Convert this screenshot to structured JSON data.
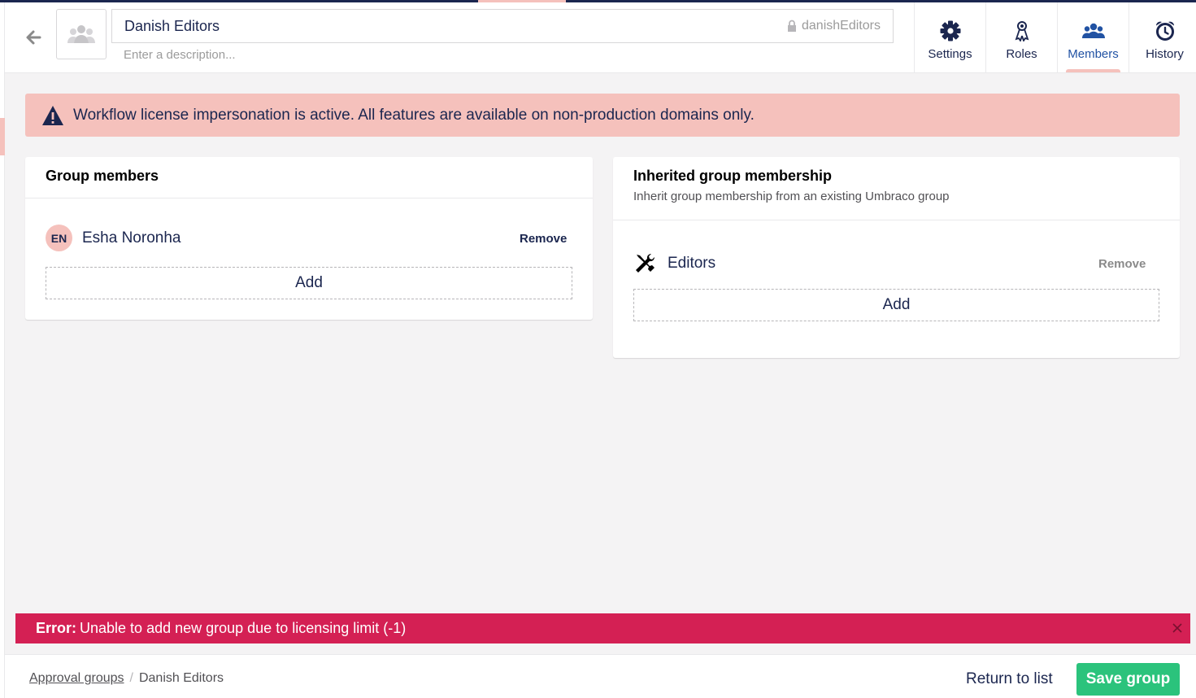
{
  "header": {
    "group_name": "Danish Editors",
    "alias": "danishEditors",
    "description_placeholder": "Enter a description...",
    "tabs": [
      {
        "label": "Settings",
        "icon": "gear-icon"
      },
      {
        "label": "Roles",
        "icon": "roles-icon"
      },
      {
        "label": "Members",
        "icon": "users-icon",
        "active": true
      },
      {
        "label": "History",
        "icon": "alarm-clock-icon"
      }
    ]
  },
  "banner": {
    "text": "Workflow license impersonation is active. All features are available on non-production domains only."
  },
  "group_members": {
    "title": "Group members",
    "members": [
      {
        "initials": "EN",
        "name": "Esha Noronha",
        "remove_label": "Remove"
      }
    ],
    "add_label": "Add"
  },
  "inherited": {
    "title": "Inherited group membership",
    "subtitle": "Inherit group membership from an existing Umbraco group",
    "groups": [
      {
        "name": "Editors",
        "icon": "tools-icon",
        "remove_label": "Remove"
      }
    ],
    "add_label": "Add"
  },
  "error": {
    "prefix": "Error:",
    "message": "Unable to add new group due to licensing limit (-1)"
  },
  "footer": {
    "breadcrumb": [
      "Approval groups",
      "Danish Editors"
    ],
    "breadcrumb_separator": "/",
    "return_label": "Return to list",
    "save_label": "Save group"
  },
  "colors": {
    "navy": "#1b264f",
    "pink": "#f5c1bc",
    "error": "#d42054",
    "save": "#2bc37c"
  }
}
